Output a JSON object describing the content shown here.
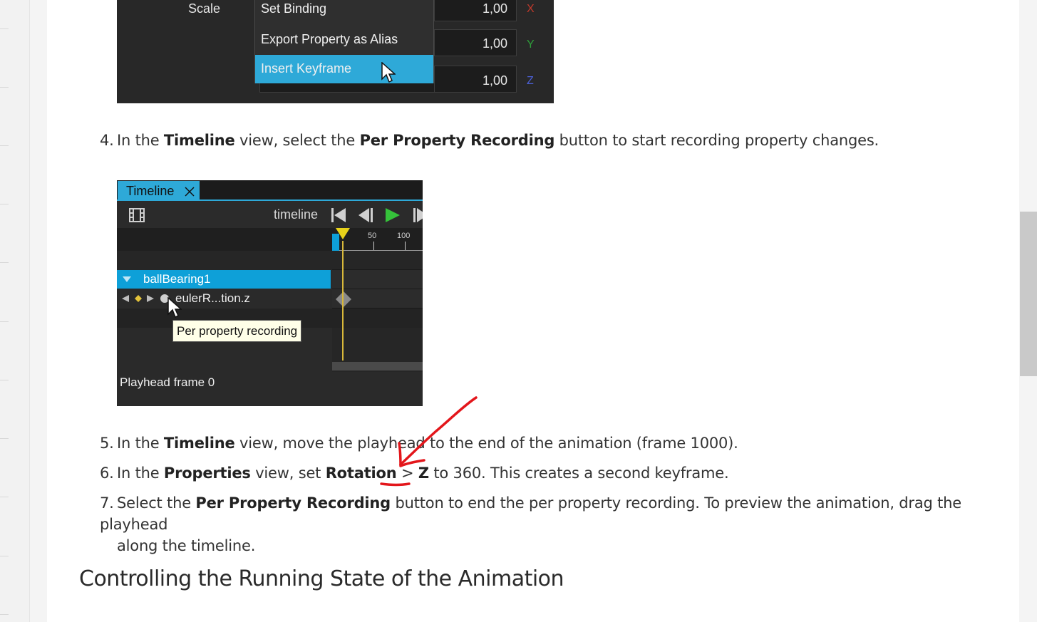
{
  "menu_shot": {
    "scale_label": "Scale",
    "menu_items": [
      "Set Binding",
      "Export Property as Alias",
      "Insert Keyframe"
    ],
    "fields": [
      {
        "value": "1,00",
        "axis": "X",
        "axis_color": "#c0392b"
      },
      {
        "value": "1,00",
        "axis": "Y",
        "axis_color": "#2e9e3a"
      },
      {
        "value": "1,00",
        "axis": "Z",
        "axis_color": "#4b5fd6"
      }
    ]
  },
  "steps": {
    "s4": {
      "num": "4.",
      "t1": "In the ",
      "b1": "Timeline",
      "t2": " view, select the ",
      "b2": "Per Property Recording",
      "t3": " button to start recording property changes."
    },
    "s5": {
      "num": "5.",
      "t1": "In the ",
      "b1": "Timeline",
      "t2": " view, move the playhead to the end of the animation (frame 1000)."
    },
    "s6": {
      "num": "6.",
      "t1": "In the ",
      "b1": "Properties",
      "t2": " view, set ",
      "b2": "Rotation",
      "t3": " > ",
      "b3": "Z",
      "t4": " to 360. This creates a second keyframe."
    },
    "s7": {
      "num": "7.",
      "t1": "Select the ",
      "b1": "Per Property Recording",
      "t2": " button to end the per property recording. To preview the animation, drag the playhead",
      "t3": "along the timeline."
    }
  },
  "timeline_shot": {
    "tab_label": "Timeline",
    "toolbar_label": "timeline",
    "ruler_ticks": [
      "50",
      "100"
    ],
    "node_name": "ballBearing1",
    "property_name": "eulerR...tion.z",
    "tooltip": "Per property recording",
    "playhead_label": "Playhead frame 0",
    "accent": "#2ea9d8"
  },
  "annotation_color": "#e3161b",
  "section_heading": "Controlling the Running State of the Animation"
}
